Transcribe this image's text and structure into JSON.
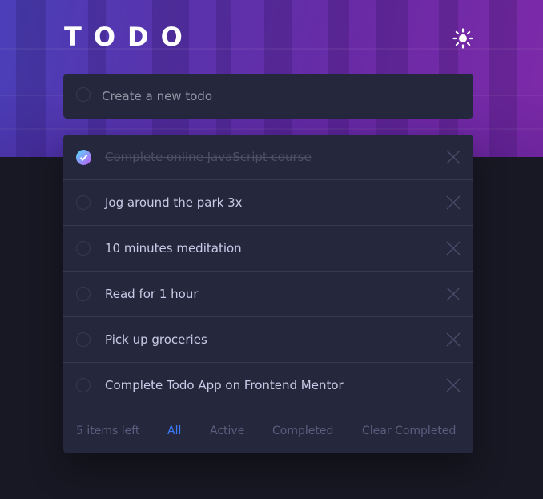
{
  "app": {
    "title": "TODO",
    "theme_icon": "sun-icon"
  },
  "new_todo": {
    "placeholder": "Create a new todo",
    "value": ""
  },
  "todos": [
    {
      "text": "Complete online JavaScript course",
      "completed": true
    },
    {
      "text": "Jog around the park 3x",
      "completed": false
    },
    {
      "text": "10 minutes meditation",
      "completed": false
    },
    {
      "text": "Read for 1 hour",
      "completed": false
    },
    {
      "text": "Pick up groceries",
      "completed": false
    },
    {
      "text": "Complete Todo App on Frontend Mentor",
      "completed": false
    }
  ],
  "footer": {
    "items_left": "5 items left",
    "filters": [
      {
        "label": "All",
        "active": true
      },
      {
        "label": "Active",
        "active": false
      },
      {
        "label": "Completed",
        "active": false
      }
    ],
    "clear_label": "Clear Completed"
  },
  "colors": {
    "accent": "#3a7cfd",
    "card": "#25273c",
    "background": "#181824",
    "check_gradient_start": "#55ddff",
    "check_gradient_end": "#c058f3"
  }
}
